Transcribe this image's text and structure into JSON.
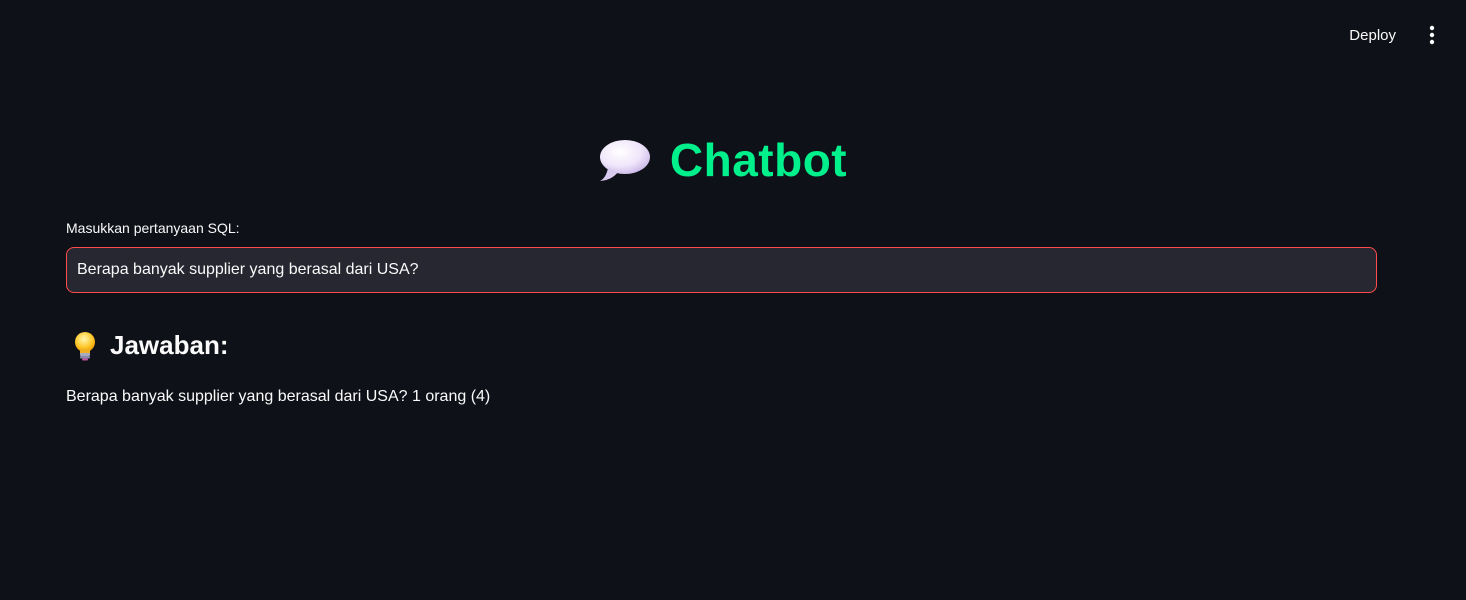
{
  "toolbar": {
    "deploy_label": "Deploy",
    "menu_icon": "kebab-menu-icon"
  },
  "header": {
    "title": "Chatbot",
    "title_icon": "speech-bubble-icon"
  },
  "form": {
    "label": "Masukkan pertanyaan SQL:",
    "value": "Berapa banyak supplier yang berasal dari USA?"
  },
  "answer": {
    "heading": "Jawaban:",
    "heading_icon": "lightbulb-icon",
    "text": "Berapa banyak supplier yang berasal dari USA? 1 orang (4)"
  },
  "colors": {
    "background": "#0e1117",
    "title": "#00f08c",
    "input_border": "#ff4b4b",
    "input_bg": "#262730",
    "text": "#fafafa"
  }
}
